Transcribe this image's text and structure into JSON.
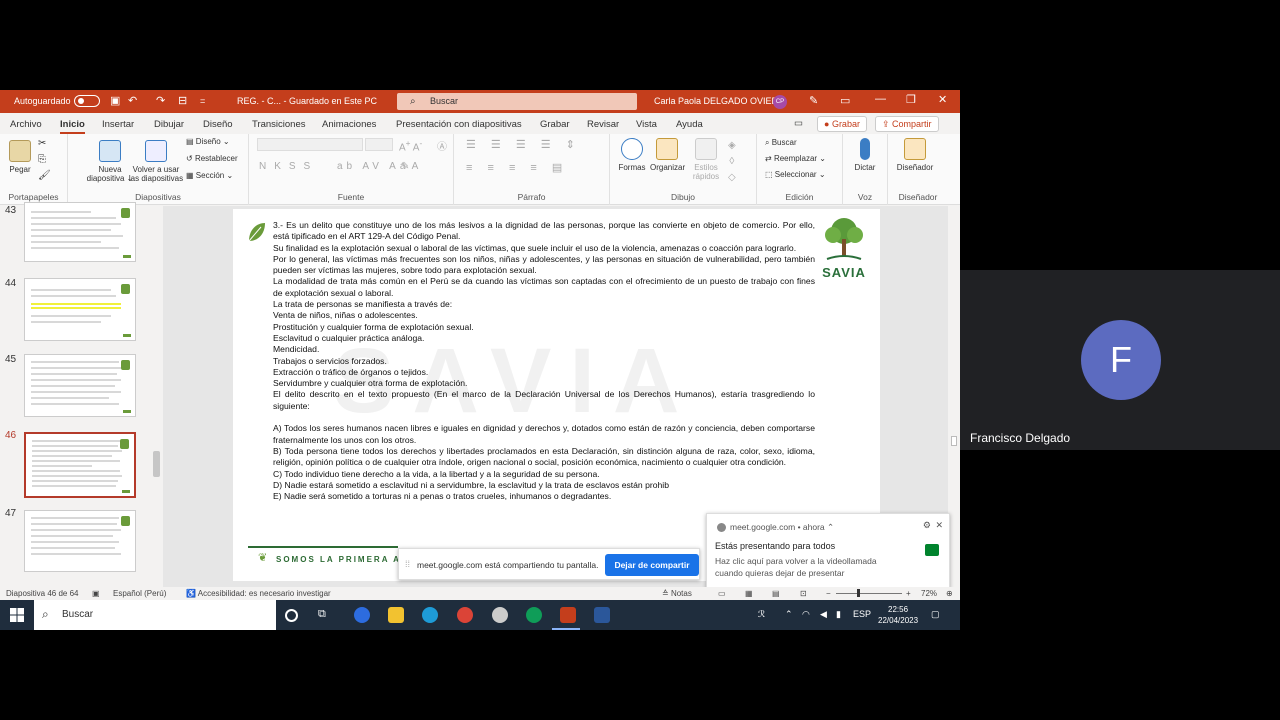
{
  "titlebar": {
    "autosave_label": "Autoguardado",
    "doc_title": "REG. - C... - Guardado en Este PC",
    "search_placeholder": "Buscar",
    "user_name": "Carla Paola DELGADO OVIEDO",
    "user_initials": "CP"
  },
  "menu": {
    "items": [
      "Archivo",
      "Inicio",
      "Insertar",
      "Dibujar",
      "Diseño",
      "Transiciones",
      "Animaciones",
      "Presentación con diapositivas",
      "Grabar",
      "Revisar",
      "Vista",
      "Ayuda"
    ],
    "grabar_button": "Grabar",
    "share_button": "Compartir"
  },
  "ribbon": {
    "pegar": "Pegar",
    "nueva": "Nueva",
    "diapositiva": "diapositiva",
    "volver": "Volver a usar",
    "las_diapositivas": "las diapositivas",
    "diseno": "Diseño",
    "restablecer": "Restablecer",
    "seccion": "Sección",
    "formas": "Formas",
    "organizar": "Organizar",
    "estilos": "Estilos",
    "rapidos": "rápidos",
    "buscar": "Buscar",
    "reemplazar": "Reemplazar",
    "seleccionar": "Seleccionar",
    "dictar": "Dictar",
    "disenador": "Diseñador",
    "groups": {
      "portapapeles": "Portapapeles",
      "diapositivas": "Diapositivas",
      "fuente": "Fuente",
      "parrafo": "Párrafo",
      "dibujo": "Dibujo",
      "edicion": "Edición",
      "voz": "Voz",
      "disenador": "Diseñador"
    }
  },
  "thumbnails": {
    "n43": "43",
    "n44": "44",
    "n45": "45",
    "n46": "46",
    "n47": "47"
  },
  "slide": {
    "paragraphs": [
      "3.- Es un delito que constituye uno de los más lesivos a la dignidad de las personas, porque las convierte en objeto de comercio. Por ello, está tipificado en el ART 129-A del Código Penal.",
      "Su finalidad es la explotación sexual o laboral de las víctimas, que suele incluir el uso de la violencia, amenazas o coacción para lograrlo.",
      "Por lo general, las víctimas más frecuentes son los niños, niñas y adolescentes, y las personas en situación de vulnerabilidad, pero también pueden ser víctimas las mujeres, sobre todo para explotación sexual.",
      "La modalidad de trata más común en el Perú se da cuando las víctimas son captadas con el ofrecimiento de un puesto de trabajo con fines de explotación sexual o laboral.",
      "La trata de personas se manifiesta a través de:",
      "Venta de niños, niñas o adolescentes.",
      "Prostitución y cualquier forma de explotación sexual.",
      "Esclavitud o cualquier práctica análoga.",
      "Mendicidad.",
      "Trabajos o servicios forzados.",
      "Extracción o tráfico de órganos o tejidos.",
      "Servidumbre y cualquier otra forma de explotación.",
      "El delito descrito en el texto propuesto (En el marco de la Declaración Universal de los Derechos Humanos), estaría trasgrediendo lo siguiente:",
      "",
      "A) Todos los seres humanos nacen libres e iguales en dignidad y derechos y, dotados como están de razón y conciencia, deben comportarse fraternalmente los unos con los otros.",
      "B) Toda persona tiene todos los derechos y libertades proclamados en esta Declaración, sin distinción alguna de raza, color, sexo, idioma, religión, opinión política o de cualquier otra índole, origen nacional o social, posición económica, nacimiento o cualquier otra condición.",
      "C) Todo individuo tiene derecho a la vida, a la libertad y a la seguridad de su persona.",
      "D) Nadie estará sometido a esclavitud ni a servidumbre, la esclavitud y la trata de esclavos están prohib",
      "E) Nadie será sometido a torturas ni a penas o tratos crueles, inhumanos o degradantes."
    ],
    "logo_text": "SAVIA",
    "footer_text": "SOMOS LA PRIMERA ACA"
  },
  "sharebar": {
    "message": "meet.google.com está compartiendo tu pantalla.",
    "stop_button": "Dejar de compartir"
  },
  "notification": {
    "source": "meet.google.com",
    "time": "ahora",
    "title": "Estás presentando para todos",
    "body": "Haz clic aquí para volver a la videollamada cuando quieras dejar de presentar"
  },
  "statusbar": {
    "slide_info": "Diapositiva 46 de 64",
    "language": "Español (Perú)",
    "accessibility": "Accesibilidad: es necesario investigar",
    "notes": "Notas",
    "zoom": "72%"
  },
  "taskbar": {
    "search": "Buscar",
    "lang": "ESP",
    "time": "22:56",
    "date": "22/04/2023"
  },
  "participant": {
    "initial": "F",
    "name": "Francisco Delgado"
  }
}
